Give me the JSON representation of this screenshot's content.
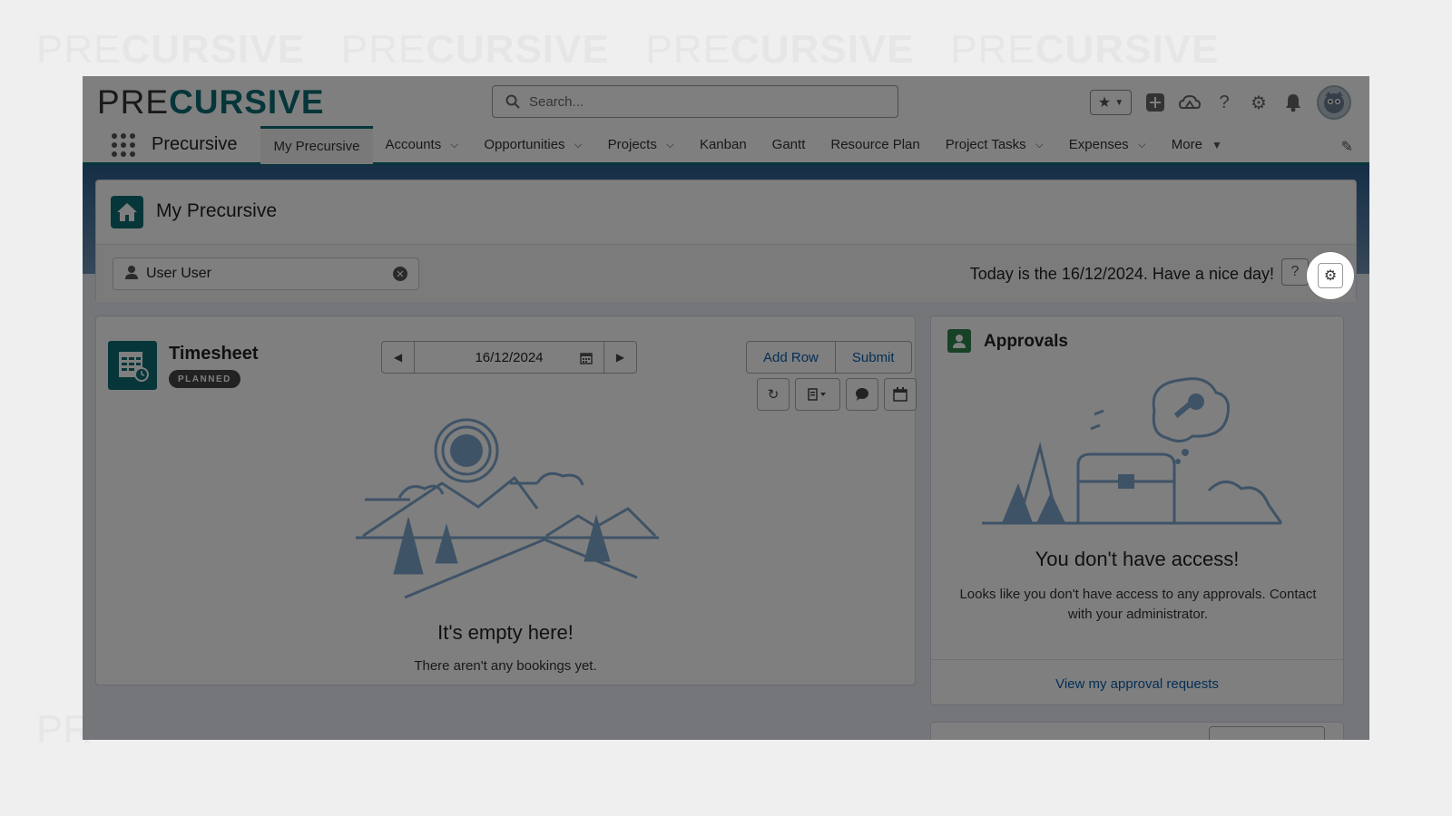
{
  "watermark": {
    "light": "PRE",
    "bold": "CURSIVE",
    "side": "PR"
  },
  "header": {
    "logo_pre": "PRE",
    "logo_cursive": "CURSIVE",
    "search_placeholder": "Search...",
    "icons": [
      "star-icon",
      "chevron-down-icon",
      "add-icon",
      "trailhead-icon",
      "help-icon",
      "setup-gear-icon",
      "bell-icon",
      "avatar"
    ]
  },
  "nav": {
    "app_name": "Precursive",
    "items": [
      {
        "label": "My Precursive",
        "active": true,
        "has_menu": false
      },
      {
        "label": "Accounts",
        "active": false,
        "has_menu": true
      },
      {
        "label": "Opportunities",
        "active": false,
        "has_menu": true
      },
      {
        "label": "Projects",
        "active": false,
        "has_menu": true
      },
      {
        "label": "Kanban",
        "active": false,
        "has_menu": false
      },
      {
        "label": "Gantt",
        "active": false,
        "has_menu": false
      },
      {
        "label": "Resource Plan",
        "active": false,
        "has_menu": false
      },
      {
        "label": "Project Tasks",
        "active": false,
        "has_menu": true
      },
      {
        "label": "Expenses",
        "active": false,
        "has_menu": true
      },
      {
        "label": "More",
        "active": false,
        "has_menu": true
      }
    ]
  },
  "page": {
    "title": "My Precursive",
    "user_filter": "User User",
    "greeting": "Today is the 16/12/2024. Have a nice day!",
    "help_label": "?"
  },
  "timesheet": {
    "title": "Timesheet",
    "badge": "PLANNED",
    "date": "16/12/2024",
    "add_row_label": "Add Row",
    "submit_label": "Submit",
    "empty_title": "It's empty here!",
    "empty_text": "There aren't any bookings yet."
  },
  "approvals": {
    "title": "Approvals",
    "heading": "You don't have access!",
    "text": "Looks like you don't have access to any approvals. Contact with your administrator.",
    "link": "View my approval requests"
  },
  "colors": {
    "brand_teal": "#0d6d75",
    "link_blue": "#0b5cab",
    "approvals_green": "#2e844a"
  }
}
